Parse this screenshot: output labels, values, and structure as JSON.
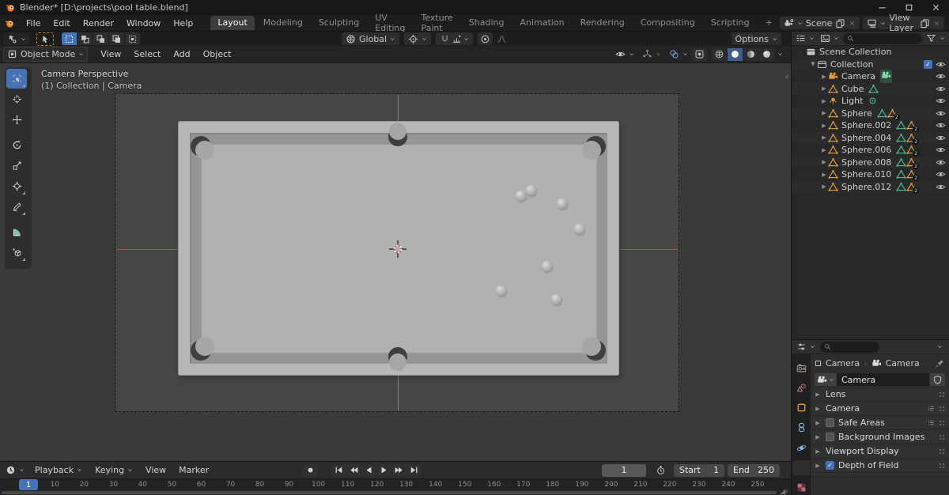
{
  "window": {
    "title": "Blender* [D:\\projects\\pool table.blend]",
    "controls": [
      "minimize",
      "maximize",
      "close"
    ]
  },
  "colors": {
    "accent_blue": "#4772b3",
    "object_orange": "#dd9b44",
    "data_green": "#4db888",
    "axis_red": "#a3524a",
    "axis_green": "#7e8f45",
    "table_gray": "#b7b7b7"
  },
  "topbar": {
    "menus": [
      "File",
      "Edit",
      "Render",
      "Window",
      "Help"
    ],
    "workspaces": [
      "Layout",
      "Modeling",
      "Sculpting",
      "UV Editing",
      "Texture Paint",
      "Shading",
      "Animation",
      "Rendering",
      "Compositing",
      "Scripting"
    ],
    "active_workspace": "Layout",
    "add_workspace_label": "+",
    "scene_label": "Scene",
    "view_layer_label": "View Layer"
  },
  "tool_settings": {
    "orientation": "Global",
    "options_label": "Options",
    "select_modes": [
      "select-set",
      "select-extend",
      "select-subtract",
      "select-invert",
      "select-intersect"
    ],
    "active_select_mode": 0
  },
  "viewport": {
    "mode": "Object Mode",
    "menus": [
      "View",
      "Select",
      "Add",
      "Object"
    ],
    "overlay_line1": "Camera Perspective",
    "overlay_line2": "(1) Collection | Camera",
    "shading_modes": [
      "wireframe",
      "solid",
      "material-preview",
      "rendered"
    ],
    "active_shading": "solid",
    "tools": [
      "tool-select-box",
      "tool-cursor",
      "tool-move",
      "tool-rotate",
      "tool-scale",
      "tool-transform",
      "tool-annotate",
      "tool-measure",
      "tool-add-cube"
    ],
    "active_tool": 0,
    "balls": [
      [
        658,
        247
      ],
      [
        671,
        240
      ],
      [
        710,
        257
      ],
      [
        732,
        289
      ],
      [
        691,
        336
      ],
      [
        633,
        367
      ],
      [
        703,
        378
      ]
    ]
  },
  "outliner": {
    "rows": [
      {
        "label": "Scene Collection",
        "icon": "scenecoll",
        "arrow": "",
        "indent": 0,
        "badges": [],
        "checkbox": null,
        "eye": false
      },
      {
        "label": "Collection",
        "icon": "collection",
        "arrow": "down",
        "indent": 1,
        "badges": [],
        "checkbox": "on",
        "eye": true
      },
      {
        "label": "Camera",
        "icon": "camera-orange",
        "arrow": "right",
        "indent": 2,
        "badges": [
          "camera-active"
        ],
        "checkbox": null,
        "eye": true
      },
      {
        "label": "Cube",
        "icon": "mesh-orange",
        "arrow": "right",
        "indent": 2,
        "badges": [
          "mesh-green"
        ],
        "checkbox": null,
        "eye": true
      },
      {
        "label": "Light",
        "icon": "light-orange",
        "arrow": "right",
        "indent": 2,
        "badges": [
          "light-green"
        ],
        "checkbox": null,
        "eye": true
      },
      {
        "label": "Sphere",
        "icon": "mesh-orange",
        "arrow": "right",
        "indent": 2,
        "badges": [
          "mesh-green",
          "mesh2"
        ],
        "checkbox": null,
        "eye": true
      },
      {
        "label": "Sphere.002",
        "icon": "mesh-orange",
        "arrow": "right",
        "indent": 2,
        "badges": [
          "mesh-green",
          "mesh2"
        ],
        "checkbox": null,
        "eye": true
      },
      {
        "label": "Sphere.004",
        "icon": "mesh-orange",
        "arrow": "right",
        "indent": 2,
        "badges": [
          "mesh-green",
          "mesh2"
        ],
        "checkbox": null,
        "eye": true
      },
      {
        "label": "Sphere.006",
        "icon": "mesh-orange",
        "arrow": "right",
        "indent": 2,
        "badges": [
          "mesh-green",
          "mesh2"
        ],
        "checkbox": null,
        "eye": true
      },
      {
        "label": "Sphere.008",
        "icon": "mesh-orange",
        "arrow": "right",
        "indent": 2,
        "badges": [
          "mesh-green",
          "mesh2"
        ],
        "checkbox": null,
        "eye": true
      },
      {
        "label": "Sphere.010",
        "icon": "mesh-orange",
        "arrow": "right",
        "indent": 2,
        "badges": [
          "mesh-green",
          "mesh2"
        ],
        "checkbox": null,
        "eye": true
      },
      {
        "label": "Sphere.012",
        "icon": "mesh-orange",
        "arrow": "right",
        "indent": 2,
        "badges": [
          "mesh-green",
          "mesh2"
        ],
        "checkbox": null,
        "eye": true
      }
    ]
  },
  "properties": {
    "tabs": [
      "tab-render",
      "tab-scene",
      "tab-object",
      "tab-constraint",
      "tab-physics",
      "tab-data",
      "tab-texture"
    ],
    "active_tab": "tab-data",
    "breadcrumb_object": "Camera",
    "breadcrumb_data": "Camera",
    "datablock_name": "Camera",
    "panels": [
      {
        "label": "Lens",
        "checkbox": null,
        "list": false
      },
      {
        "label": "Camera",
        "checkbox": null,
        "list": true
      },
      {
        "label": "Safe Areas",
        "checkbox": "off",
        "list": true
      },
      {
        "label": "Background Images",
        "checkbox": "off",
        "list": false
      },
      {
        "label": "Viewport Display",
        "checkbox": null,
        "list": false
      },
      {
        "label": "Depth of Field",
        "checkbox": "on",
        "list": false
      }
    ]
  },
  "timeline": {
    "menus_dropdown": [
      "Playback",
      "Keying"
    ],
    "menus_plain": [
      "View",
      "Marker"
    ],
    "transport": [
      "jump-to-start",
      "prev-keyframe",
      "play-reverse",
      "play",
      "next-keyframe",
      "jump-to-end"
    ],
    "current_frame": "1",
    "start_label": "Start",
    "start_value": "1",
    "end_label": "End",
    "end_value": "250",
    "ticks": [
      1,
      10,
      20,
      30,
      40,
      50,
      60,
      70,
      80,
      90,
      100,
      110,
      120,
      130,
      140,
      150,
      160,
      170,
      180,
      190,
      200,
      210,
      220,
      230,
      240,
      250
    ],
    "frame_min": 1,
    "frame_max": 250
  }
}
